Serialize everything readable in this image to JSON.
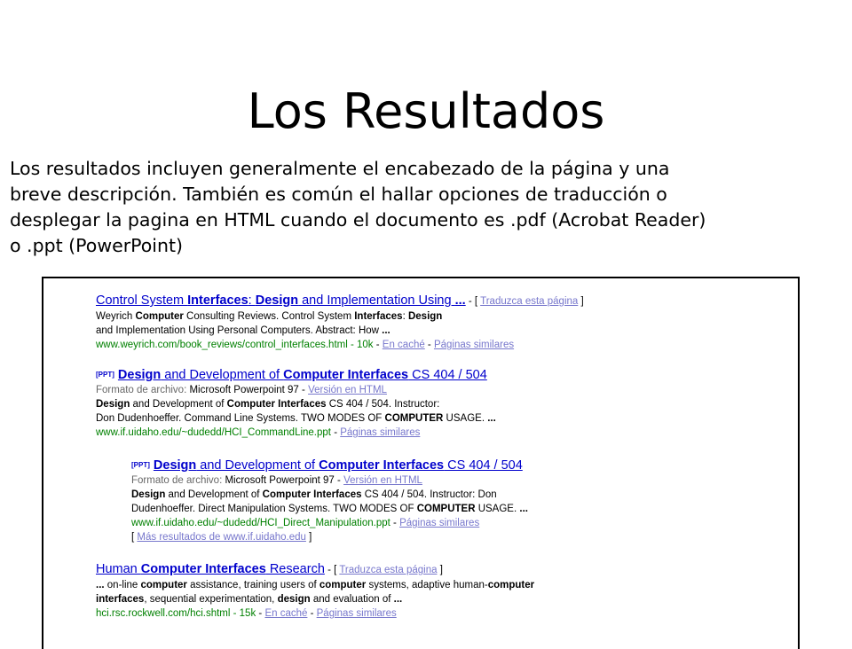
{
  "slide": {
    "title": "Los Resultados",
    "intro": [
      "Los resultados incluyen generalmente el encabezado de la página y una",
      "breve descripción. También es común el hallar opciones de traducción o",
      "desplegar la pagina en HTML cuando el documento es .pdf (Acrobat Reader)",
      "o .ppt (PowerPoint)"
    ]
  },
  "labels": {
    "translate": "Traduzca esta página",
    "cached": "En caché",
    "similar": "Páginas similares",
    "file_format": "Formato de archivo:",
    "html_version": "Versión en HTML",
    "ppt_tag": "[PPT]",
    "more_results": "Más resultados de www.if.uidaho.edu",
    "bracket_open": "[",
    "bracket_close": "]",
    "dash": " - "
  },
  "results": [
    {
      "title": [
        "Control System ",
        "Interfaces",
        ": ",
        "Design",
        " and Implementation Using ",
        "..."
      ],
      "snippet1": [
        "Weyrich ",
        "Computer",
        " Consulting Reviews. Control System ",
        "Interfaces",
        ": ",
        "Design"
      ],
      "snippet2": [
        "and Implementation Using Personal Computers. Abstract: How ",
        "..."
      ],
      "url": "www.weyrich.com/book_reviews/control_interfaces.html - 10k"
    },
    {
      "title": [
        "Design",
        " and Development of ",
        "Computer Interfaces",
        " CS 404 / 504"
      ],
      "format": "Microsoft Powerpoint 97",
      "snippet1": [
        "Design",
        " and Development of ",
        "Computer Interfaces",
        " CS 404 / 504. Instructor:"
      ],
      "snippet2": [
        "Don Dudenhoeffer. Command Line Systems. TWO MODES OF ",
        "COMPUTER",
        " USAGE. ",
        "..."
      ],
      "url": "www.if.uidaho.edu/~dudedd/HCI_CommandLine.ppt"
    },
    {
      "title": [
        "Design",
        " and Development of ",
        "Computer Interfaces",
        " CS 404 / 504"
      ],
      "format": "Microsoft Powerpoint 97",
      "snippet1": [
        "Design",
        " and Development of ",
        "Computer Interfaces",
        " CS 404 / 504. Instructor: Don"
      ],
      "snippet2": [
        "Dudenhoeffer. Direct Manipulation Systems. TWO MODES OF ",
        "COMPUTER",
        " USAGE. ",
        "..."
      ],
      "url": "www.if.uidaho.edu/~dudedd/HCI_Direct_Manipulation.ppt"
    },
    {
      "title": [
        "Human ",
        "Computer Interfaces",
        " Research"
      ],
      "snippet1": [
        "...",
        " on-line ",
        "computer",
        " assistance, training users of ",
        "computer",
        " systems, adaptive human-",
        "computer"
      ],
      "snippet2": [
        "interfaces",
        ", sequential experimentation, ",
        "design",
        " and evaluation of ",
        "..."
      ],
      "url": "hci.rsc.rockwell.com/hci.shtml - 15k"
    }
  ]
}
